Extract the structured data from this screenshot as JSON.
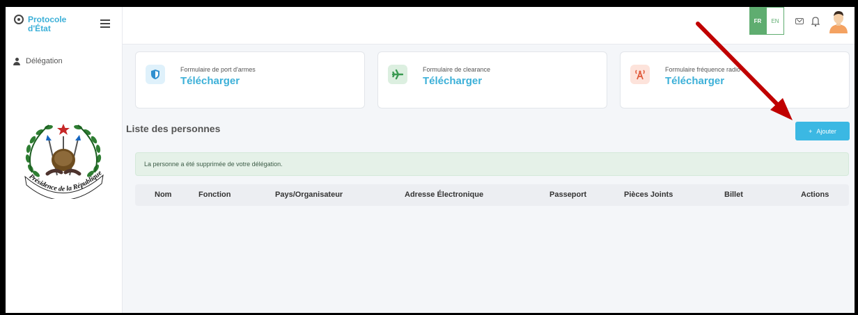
{
  "brand": {
    "name": "Protocole d'État"
  },
  "sidebar": {
    "items": [
      {
        "label": "Délégation",
        "icon": "user-icon"
      }
    ]
  },
  "emblem": {
    "text": "Présidence de la République"
  },
  "topbar": {
    "lang_fr": "FR",
    "lang_en": "EN",
    "icons": [
      "mail-icon",
      "bell-icon",
      "avatar"
    ]
  },
  "cards": [
    {
      "label": "Formulaire de port d'armes",
      "link": "Télécharger",
      "icon": "shield-icon",
      "color": "#2f8fcf"
    },
    {
      "label": "Formulaire de clearance",
      "link": "Télécharger",
      "icon": "plane-icon",
      "color": "#3a9a52"
    },
    {
      "label": "Formulaire fréquence radio",
      "link": "Télécharger",
      "icon": "radio-icon",
      "color": "#e05a3a"
    }
  ],
  "list": {
    "title": "Liste des personnes",
    "add_label": "Ajouter",
    "alert": "La personne a été supprimée de votre délégation.",
    "columns": [
      "Nom",
      "Fonction",
      "Pays/Organisateur",
      "Adresse Électronique",
      "Passeport",
      "Pièces Joints",
      "Billet",
      "Actions"
    ]
  },
  "colors": {
    "accent": "#3cb0d8",
    "success": "#5fad70",
    "annotation_arrow": "#c00000"
  }
}
